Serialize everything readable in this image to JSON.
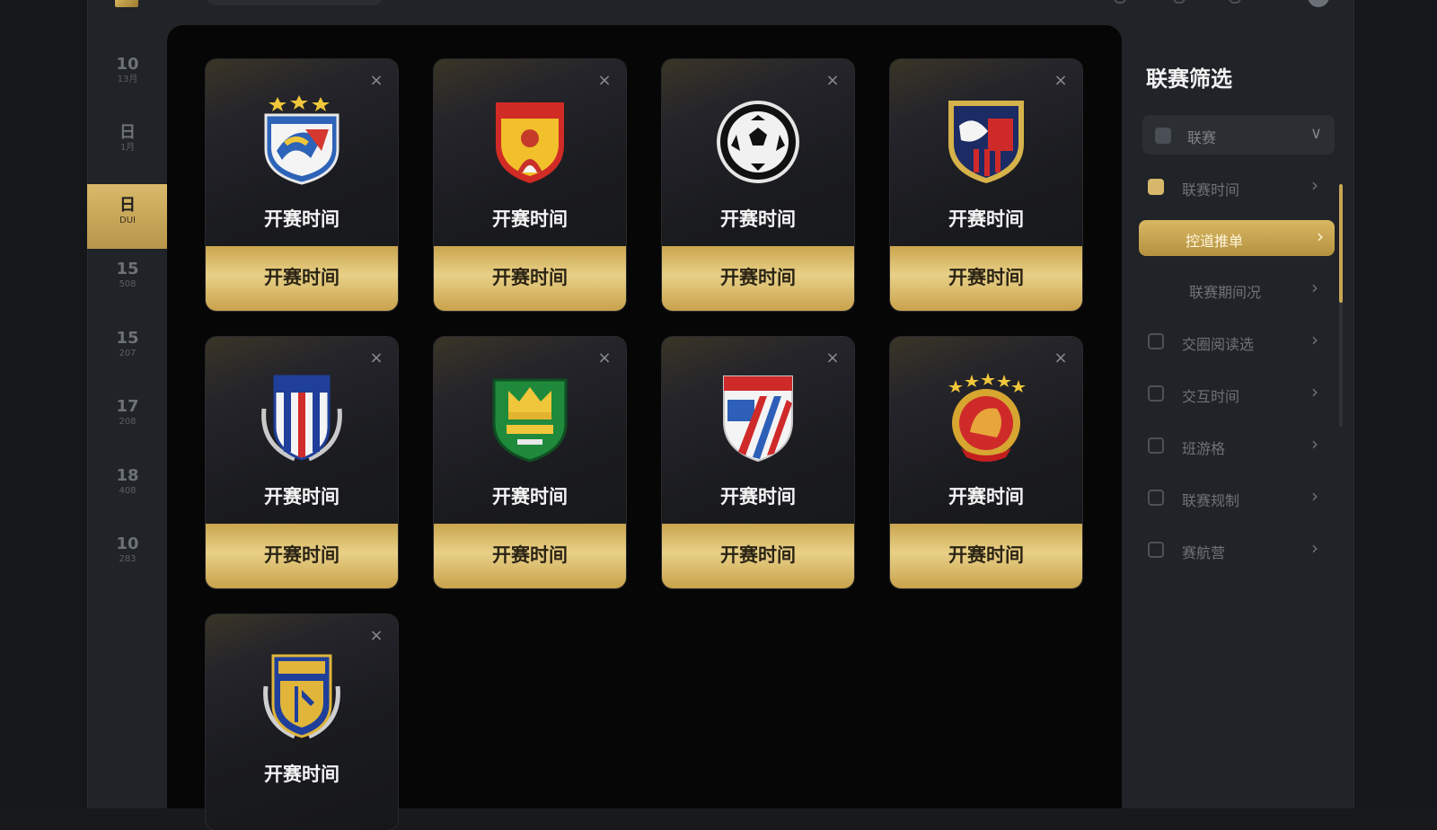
{
  "date_rail": {
    "items": [
      {
        "num": "10",
        "sub": "13月"
      },
      {
        "num": "日",
        "sub": "1月"
      },
      {
        "num": "日",
        "sub": "DUI"
      },
      {
        "num": "15",
        "sub": "508"
      },
      {
        "num": "15",
        "sub": "207"
      },
      {
        "num": "17",
        "sub": "208"
      },
      {
        "num": "18",
        "sub": "408"
      },
      {
        "num": "10",
        "sub": "283"
      }
    ],
    "active_index": 2
  },
  "cards": [
    {
      "name": "开赛时间",
      "action": "开赛时间",
      "crest": "blue-white-star-shield-crest"
    },
    {
      "name": "开赛时间",
      "action": "开赛时间",
      "crest": "red-gold-shield-crest"
    },
    {
      "name": "开赛时间",
      "action": "开赛时间",
      "crest": "soccer-ball-crest"
    },
    {
      "name": "开赛时间",
      "action": "开赛时间",
      "crest": "navy-red-shield-crest"
    },
    {
      "name": "开赛时间",
      "action": "开赛时间",
      "crest": "blue-red-striped-laurel-crest"
    },
    {
      "name": "开赛时间",
      "action": "开赛时间",
      "crest": "green-crown-shield-crest"
    },
    {
      "name": "开赛时间",
      "action": "开赛时间",
      "crest": "red-blue-striped-shield-crest"
    },
    {
      "name": "开赛时间",
      "action": "开赛时间",
      "crest": "red-gold-lion-star-crest"
    },
    {
      "name": "开赛时间",
      "action": "",
      "crest": "blue-gold-laurel-crest"
    }
  ],
  "close_icon": "×",
  "filter": {
    "title": "联赛筛选",
    "select": {
      "label": "联赛",
      "chevron": "∨"
    },
    "rows": [
      {
        "label": "联赛时间",
        "checked": true
      },
      {
        "label": "控道推单",
        "active": true
      },
      {
        "label": "联赛期间况"
      },
      {
        "label": "交圈阅读选"
      },
      {
        "label": "交互时间"
      },
      {
        "label": "班游格"
      },
      {
        "label": "联赛规制"
      },
      {
        "label": "赛航营"
      }
    ],
    "chevron_right": "›"
  },
  "colors": {
    "gold_accent": "#d7b86b",
    "panel_bg": "#060606",
    "app_bg": "#202327"
  }
}
